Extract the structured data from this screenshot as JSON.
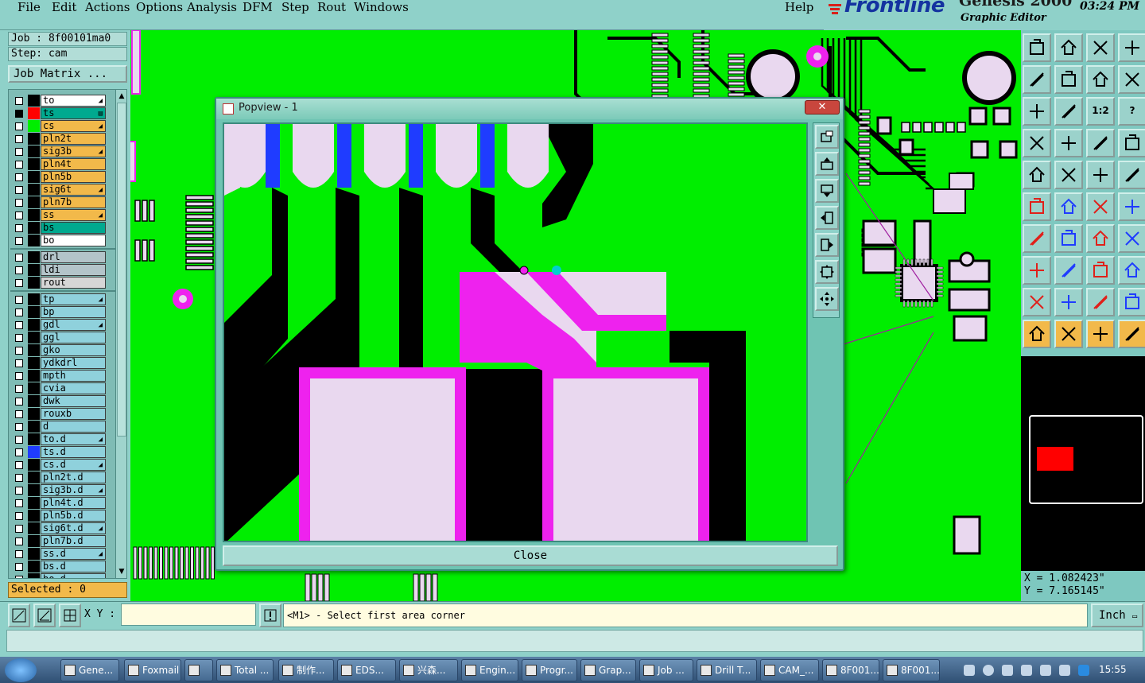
{
  "menu": [
    "File",
    "Edit",
    "Actions",
    "Options",
    "Analysis",
    "DFM",
    "Step",
    "Rout",
    "Windows",
    "Help"
  ],
  "brand": {
    "logo": "Frontline",
    "product": "Genesis 2000",
    "subtitle": "Graphic Editor",
    "clock": "03:24 PM"
  },
  "job": {
    "job_label": "Job : 8f00101ma0",
    "step_label": "Step: cam",
    "matrix_button": "Job Matrix ..."
  },
  "layers": [
    {
      "name": "to",
      "color": "#ffffff",
      "swatch": "#000000",
      "mark": "◢"
    },
    {
      "name": "ts",
      "color": "#00a98f",
      "swatch": "#ff0000",
      "mark": "▤",
      "active": true
    },
    {
      "name": "cs",
      "color": "#f2b94a",
      "swatch": "#00ee00",
      "mark": "◢"
    },
    {
      "name": "pln2t",
      "color": "#f2b94a",
      "swatch": "#000000",
      "mark": ""
    },
    {
      "name": "sig3b",
      "color": "#f2b94a",
      "swatch": "#000000",
      "mark": "◢"
    },
    {
      "name": "pln4t",
      "color": "#f2b94a",
      "swatch": "#000000",
      "mark": ""
    },
    {
      "name": "pln5b",
      "color": "#f2b94a",
      "swatch": "#000000",
      "mark": ""
    },
    {
      "name": "sig6t",
      "color": "#f2b94a",
      "swatch": "#000000",
      "mark": "◢"
    },
    {
      "name": "pln7b",
      "color": "#f2b94a",
      "swatch": "#000000",
      "mark": ""
    },
    {
      "name": "ss",
      "color": "#f2b94a",
      "swatch": "#000000",
      "mark": "◢"
    },
    {
      "name": "bs",
      "color": "#00a98f",
      "swatch": "#000000",
      "mark": ""
    },
    {
      "name": "bo",
      "color": "#ffffff",
      "swatch": "#000000",
      "mark": ""
    },
    {
      "name": "drl",
      "color": "#b3c4c9",
      "swatch": "#000000",
      "mark": "",
      "group_start": true
    },
    {
      "name": "ldi",
      "color": "#b3c4c9",
      "swatch": "#000000",
      "mark": ""
    },
    {
      "name": "rout",
      "color": "#d6d6d6",
      "swatch": "#000000",
      "mark": ""
    },
    {
      "name": "tp",
      "color": "#8fd1dc",
      "swatch": "#000000",
      "mark": "◢",
      "group_start": true
    },
    {
      "name": "bp",
      "color": "#8fd1dc",
      "swatch": "#000000",
      "mark": ""
    },
    {
      "name": "gdl",
      "color": "#8fd1dc",
      "swatch": "#000000",
      "mark": "◢"
    },
    {
      "name": "ggl",
      "color": "#8fd1dc",
      "swatch": "#000000",
      "mark": ""
    },
    {
      "name": "gko",
      "color": "#8fd1dc",
      "swatch": "#000000",
      "mark": ""
    },
    {
      "name": "ydkdrl",
      "color": "#8fd1dc",
      "swatch": "#000000",
      "mark": ""
    },
    {
      "name": "mpth",
      "color": "#8fd1dc",
      "swatch": "#000000",
      "mark": ""
    },
    {
      "name": "cvia",
      "color": "#8fd1dc",
      "swatch": "#000000",
      "mark": ""
    },
    {
      "name": "dwk",
      "color": "#8fd1dc",
      "swatch": "#000000",
      "mark": ""
    },
    {
      "name": "rouxb",
      "color": "#8fd1dc",
      "swatch": "#000000",
      "mark": ""
    },
    {
      "name": "d",
      "color": "#8fd1dc",
      "swatch": "#000000",
      "mark": ""
    },
    {
      "name": "to.d",
      "color": "#8fd1dc",
      "swatch": "#000000",
      "mark": "◢"
    },
    {
      "name": "ts.d",
      "color": "#8fd1dc",
      "swatch": "#1f3cff",
      "mark": ""
    },
    {
      "name": "cs.d",
      "color": "#8fd1dc",
      "swatch": "#000000",
      "mark": "◢"
    },
    {
      "name": "pln2t.d",
      "color": "#8fd1dc",
      "swatch": "#000000",
      "mark": ""
    },
    {
      "name": "sig3b.d",
      "color": "#8fd1dc",
      "swatch": "#000000",
      "mark": "◢"
    },
    {
      "name": "pln4t.d",
      "color": "#8fd1dc",
      "swatch": "#000000",
      "mark": ""
    },
    {
      "name": "pln5b.d",
      "color": "#8fd1dc",
      "swatch": "#000000",
      "mark": ""
    },
    {
      "name": "sig6t.d",
      "color": "#8fd1dc",
      "swatch": "#000000",
      "mark": "◢"
    },
    {
      "name": "pln7b.d",
      "color": "#8fd1dc",
      "swatch": "#000000",
      "mark": ""
    },
    {
      "name": "ss.d",
      "color": "#8fd1dc",
      "swatch": "#000000",
      "mark": "◢"
    },
    {
      "name": "bs.d",
      "color": "#8fd1dc",
      "swatch": "#000000",
      "mark": ""
    },
    {
      "name": "bo.d",
      "color": "#8fd1dc",
      "swatch": "#000000",
      "mark": ""
    }
  ],
  "selected_label": "Selected : 0",
  "popview": {
    "title": "Popview - 1",
    "close_label": "Close"
  },
  "coords": {
    "x": "X = 1.082423\"",
    "y": "Y = 7.165145\""
  },
  "input": {
    "xy_label": "X Y :",
    "xy_value": "",
    "prompt": "<M1> - Select first area corner",
    "units": "Inch"
  },
  "toolbar_icons": [
    "zoom-home",
    "zoom-in-window",
    "home",
    "zoom-fit",
    "pan-left",
    "pan-right",
    "redraw",
    "snap-line",
    "zoom-window",
    "zoom-center",
    "scale-1-2",
    "help",
    "cut-tool",
    "pad-tool",
    "layer-compare",
    "layer-compare-2",
    "measure-point",
    "measure-line",
    "ruler",
    "snap-pad",
    "route-nodes",
    "cross-select",
    "net-red",
    "net-red-2",
    "angle-red",
    "line-red",
    "arc-tool",
    "pin-tool",
    "snap-pad-red",
    "line-minus",
    "snap-mid",
    "snap-grid",
    "triangle-red",
    "triangle-blue",
    "arch-blue",
    "arch-blue-2",
    "select-pointer",
    "select-pointer-2",
    "select-pointer-3",
    "select-pointer-4"
  ],
  "toolbar_labels": {
    "scale": "1:2",
    "help": "?"
  },
  "taskbar": [
    {
      "label": "Gene..."
    },
    {
      "label": "Foxmail"
    },
    {
      "label": ""
    },
    {
      "label": "Total ..."
    },
    {
      "label": "制作..."
    },
    {
      "label": "EDS..."
    },
    {
      "label": "兴森..."
    },
    {
      "label": "Engin..."
    },
    {
      "label": "Progr..."
    },
    {
      "label": "Grap..."
    },
    {
      "label": "Job ..."
    },
    {
      "label": "Drill T..."
    },
    {
      "label": "CAM_..."
    },
    {
      "label": "8F001..."
    },
    {
      "label": "8F001..."
    }
  ],
  "tray_clock": "15:55"
}
